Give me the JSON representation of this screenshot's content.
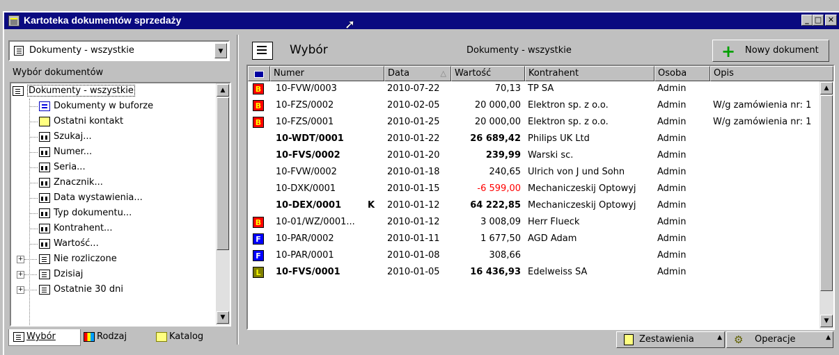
{
  "window": {
    "title": "Kartoteka dokumentów sprzedaży"
  },
  "left": {
    "combo_value": "Dokumenty - wszystkie",
    "section_label": "Wybór dokumentów",
    "tree": [
      {
        "label": "Dokumenty - wszystkie",
        "icon": "document-list-icon",
        "level": 0
      },
      {
        "label": "Dokumenty w buforze",
        "icon": "buffer-icon",
        "level": 1
      },
      {
        "label": "Ostatni kontakt",
        "icon": "contact-card-icon",
        "level": 1
      },
      {
        "label": "Szukaj...",
        "icon": "binoculars-icon",
        "level": 1
      },
      {
        "label": "Numer...",
        "icon": "binoculars-icon",
        "level": 1
      },
      {
        "label": "Seria...",
        "icon": "binoculars-icon",
        "level": 1
      },
      {
        "label": "Znacznik...",
        "icon": "binoculars-icon",
        "level": 1
      },
      {
        "label": "Data wystawienia...",
        "icon": "binoculars-icon",
        "level": 1
      },
      {
        "label": "Typ dokumentu...",
        "icon": "binoculars-icon",
        "level": 1
      },
      {
        "label": "Kontrahent...",
        "icon": "binoculars-icon",
        "level": 1
      },
      {
        "label": "Wartość...",
        "icon": "binoculars-icon",
        "level": 1
      },
      {
        "label": "Nie rozliczone",
        "icon": "document-icon",
        "level": 1
      },
      {
        "label": "Dzisiaj",
        "icon": "document-icon",
        "level": 1
      },
      {
        "label": "Ostatnie 30 dni",
        "icon": "document-icon",
        "level": 1
      }
    ],
    "tabs": [
      {
        "label": "Wybór",
        "icon": "document-icon"
      },
      {
        "label": "Rodzaj",
        "icon": "category-icon"
      },
      {
        "label": "Katalog",
        "icon": "folder-icon"
      }
    ]
  },
  "right": {
    "header_title": "Wybór",
    "header_center": "Dokumenty - wszystkie",
    "new_button": "Nowy dokument",
    "columns": [
      "Numer",
      "Data",
      "Wartość",
      "Kontrahent",
      "Osoba",
      "Opis"
    ],
    "rows": [
      {
        "badge": "B",
        "badge_color": "#ff0000",
        "numer": "10-FVW/0003",
        "flag": "",
        "data": "2010-07-22",
        "wartosc": "70,13",
        "kontrahent": "TP SA",
        "osoba": "Admin",
        "opis": "",
        "bold": false,
        "negative": false
      },
      {
        "badge": "B",
        "badge_color": "#ff0000",
        "numer": "10-FZS/0002",
        "flag": "",
        "data": "2010-02-05",
        "wartosc": "20 000,00",
        "kontrahent": "Elektron sp. z o.o.",
        "osoba": "Admin",
        "opis": "W/g zamówienia nr: 1",
        "bold": false,
        "negative": false
      },
      {
        "badge": "B",
        "badge_color": "#ff0000",
        "numer": "10-FZS/0001",
        "flag": "",
        "data": "2010-01-25",
        "wartosc": "20 000,00",
        "kontrahent": "Elektron sp. z o.o.",
        "osoba": "Admin",
        "opis": "W/g zamówienia nr: 1",
        "bold": false,
        "negative": false
      },
      {
        "badge": "",
        "badge_color": "",
        "numer": "10-WDT/0001",
        "flag": "",
        "data": "2010-01-22",
        "wartosc": "26 689,42",
        "kontrahent": "Philips UK Ltd",
        "osoba": "Admin",
        "opis": "",
        "bold": true,
        "negative": false
      },
      {
        "badge": "",
        "badge_color": "",
        "numer": "10-FVS/0002",
        "flag": "",
        "data": "2010-01-20",
        "wartosc": "239,99",
        "kontrahent": "Warski sc.",
        "osoba": "Admin",
        "opis": "",
        "bold": true,
        "negative": false
      },
      {
        "badge": "",
        "badge_color": "",
        "numer": "10-FVW/0002",
        "flag": "",
        "data": "2010-01-18",
        "wartosc": "240,65",
        "kontrahent": "Ulrich von J und Sohn",
        "osoba": "Admin",
        "opis": "",
        "bold": false,
        "negative": false
      },
      {
        "badge": "",
        "badge_color": "",
        "numer": "10-DXK/0001",
        "flag": "",
        "data": "2010-01-15",
        "wartosc": "-6 599,00",
        "kontrahent": "Mechaniczeskij Optowyj",
        "osoba": "Admin",
        "opis": "",
        "bold": false,
        "negative": true
      },
      {
        "badge": "",
        "badge_color": "",
        "numer": "10-DEX/0001",
        "flag": "K",
        "data": "2010-01-12",
        "wartosc": "64 222,85",
        "kontrahent": "Mechaniczeskij Optowyj",
        "osoba": "Admin",
        "opis": "",
        "bold": true,
        "negative": false
      },
      {
        "badge": "B",
        "badge_color": "#ff0000",
        "numer": "10-01/WZ/0001...",
        "flag": "",
        "data": "2010-01-12",
        "wartosc": "3 008,09",
        "kontrahent": "Herr Flueck",
        "osoba": "Admin",
        "opis": "",
        "bold": false,
        "negative": false
      },
      {
        "badge": "F",
        "badge_color": "#0000ff",
        "numer": "10-PAR/0002",
        "flag": "",
        "data": "2010-01-11",
        "wartosc": "1 677,50",
        "kontrahent": "AGD Adam",
        "osoba": "Admin",
        "opis": "",
        "bold": false,
        "negative": false
      },
      {
        "badge": "F",
        "badge_color": "#0000ff",
        "numer": "10-PAR/0001",
        "flag": "",
        "data": "2010-01-08",
        "wartosc": "308,66",
        "kontrahent": "",
        "osoba": "Admin",
        "opis": "",
        "bold": false,
        "negative": false
      },
      {
        "badge": "L",
        "badge_color": "#808000",
        "numer": "10-FVS/0001",
        "flag": "",
        "data": "2010-01-05",
        "wartosc": "16 436,93",
        "kontrahent": "Edelweiss SA",
        "osoba": "Admin",
        "opis": "",
        "bold": true,
        "negative": false
      }
    ],
    "bottom_buttons": [
      "Zestawienia",
      "Operacje"
    ]
  }
}
